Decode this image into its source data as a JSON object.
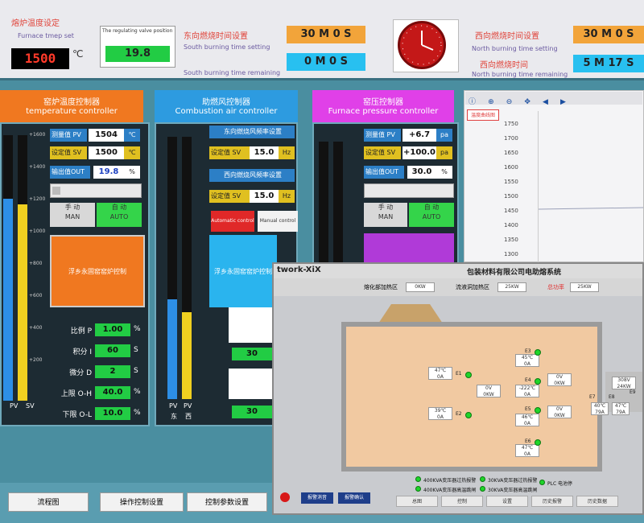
{
  "colors": {
    "teal": "#4a8ea0",
    "orange": "#f07820",
    "blue": "#2d9be0",
    "magenta": "#e040e8",
    "green": "#22cc44",
    "red": "#ff3a2a"
  },
  "topbar": {
    "furnace_temp": {
      "cn": "熔炉温度设定",
      "en": "Furnace tmep set",
      "value": "1500",
      "unit": "℃"
    },
    "regulating": {
      "label": "The regulating valve position",
      "value": "19.8"
    },
    "south_setting": {
      "cn": "东向燃烧时间设置",
      "en": "South burning time setting",
      "m": "30",
      "s": "0",
      "m_label": "M",
      "s_label": "S"
    },
    "south_remaining": {
      "en": "South burning time remaining",
      "m": "0",
      "s": "0",
      "m_label": "M",
      "s_label": "S"
    },
    "north_setting": {
      "cn": "西向燃烧时间设置",
      "en": "North burning time setting",
      "m": "30",
      "s": "0",
      "m_label": "M",
      "s_label": "S"
    },
    "north_remaining": {
      "cn": "西向燃烧时间",
      "en": "North burning time remaining",
      "m": "5",
      "s": "17",
      "m_label": "M",
      "s_label": "S"
    }
  },
  "temp_ctrl": {
    "title_cn": "窑炉温度控制器",
    "title_en": "temperature controller",
    "pv_label": "测量值 PV",
    "pv": "1504",
    "pv_unit": "℃",
    "sv_label": "设定值 SV",
    "sv": "1500",
    "sv_unit": "℃",
    "out_label": "输出值OUT",
    "out": "19.8",
    "out_unit": "%",
    "man": "MAN",
    "auto": "AUTO",
    "man_cn": "手 动",
    "auto_cn": "自 动",
    "big_btn": "浮乡永固窑窑炉控制",
    "bar_pv": "PV",
    "bar_sv": "SV",
    "bar_pv_level": 0.76,
    "bar_sv_level": 0.74,
    "ticks": [
      "1600",
      "1400",
      "1200",
      "1000",
      "800",
      "600",
      "400",
      "200"
    ],
    "pid": [
      {
        "label": "比例 P",
        "value": "1.00",
        "unit": "%"
      },
      {
        "label": "积分 I",
        "value": "60",
        "unit": "S"
      },
      {
        "label": "微分 D",
        "value": "2",
        "unit": "S"
      },
      {
        "label": "上限 O-H",
        "value": "40.0",
        "unit": "%"
      },
      {
        "label": "下限 O-L",
        "value": "10.0",
        "unit": "%"
      }
    ]
  },
  "air_ctrl": {
    "title_cn": "助燃风控制器",
    "title_en": "Combustion air controller",
    "east_label": "东向燃烧风频率设置",
    "east_sv_label": "设定值 SV",
    "east_value": "15.0",
    "east_unit": "Hz",
    "west_label": "西向燃烧风频率设置",
    "west_sv_label": "设定值 SV",
    "west_value": "15.0",
    "west_unit": "Hz",
    "auto_ctrl": "Automatic control",
    "manual_ctrl": "Manual control",
    "big_btn": "浮乡永固窑窑炉控制",
    "bar_pv": "PV",
    "bar_pv2": "PV",
    "bar_e": "东",
    "bar_w": "西",
    "bar_level_1": 0.38,
    "bar_level_2": 0.33,
    "list_values": [
      "30",
      "30"
    ]
  },
  "press_ctrl": {
    "title_cn": "窑压控制器",
    "title_en": "Furnace pressure controller",
    "pv_label": "测量值 PV",
    "pv": "+6.7",
    "pv_unit": "pa",
    "sv_label": "设定值 SV",
    "sv": "+100.0",
    "sv_unit": "pa",
    "out_label": "输出值OUT",
    "out": "30.0",
    "out_unit": "%",
    "man": "MAN",
    "auto": "AUTO",
    "man_cn": "手 动",
    "auto_cn": "自 动"
  },
  "trend": {
    "header": "温度曲线图",
    "yticks": [
      "1750",
      "1700",
      "1650",
      "1600",
      "1550",
      "1500",
      "1450",
      "1400",
      "1350",
      "1300"
    ]
  },
  "inset": {
    "brand": "twork-XiX",
    "title": "包装材料有限公司电助熔系统",
    "melt_label": "熔化部加热区",
    "melt_value": "0KW",
    "flow_label": "流液洞加热区",
    "flow_value": "25KW",
    "total_label": "总功率",
    "total_value": "25KW",
    "electrodes": [
      {
        "name": "E1",
        "temp": "47℃",
        "amp": "0A"
      },
      {
        "name": "E2",
        "temp": "39℃",
        "amp": "0A"
      },
      {
        "name": "E3",
        "temp": "45℃",
        "amp": "0A"
      },
      {
        "name": "E4",
        "temp": "-222℃",
        "amp": "0A"
      },
      {
        "name": "E5",
        "temp": "46℃",
        "amp": "0A"
      },
      {
        "name": "E6",
        "temp": "47℃",
        "amp": "0A"
      }
    ],
    "pairs": [
      {
        "v": "0V",
        "kw": "0KW"
      },
      {
        "v": "0V",
        "kw": "0KW"
      },
      {
        "v": "0V",
        "kw": "0KW"
      }
    ],
    "right_side": {
      "e7": "E7",
      "e8": "E8",
      "e9": "E9",
      "v": "308V",
      "kw": "24KW",
      "t1": "40℃",
      "a1": "79A",
      "t2": "47℃",
      "a2": "79A"
    },
    "alarms": [
      "400KVA变压器过热报警",
      "30KVA变压器过热报警",
      "PLC 电池停",
      "400KVA变压器高温跳闸",
      "30KVA变压器高温跳闸"
    ],
    "alarm_btn": "报警消音",
    "confirm_btn": "报警确认",
    "nav": [
      "总图",
      "控制",
      "设置",
      "历史报警",
      "历史数据"
    ]
  },
  "bottom_nav": [
    "流程图",
    "操作控制设置",
    "控制参数设置"
  ]
}
